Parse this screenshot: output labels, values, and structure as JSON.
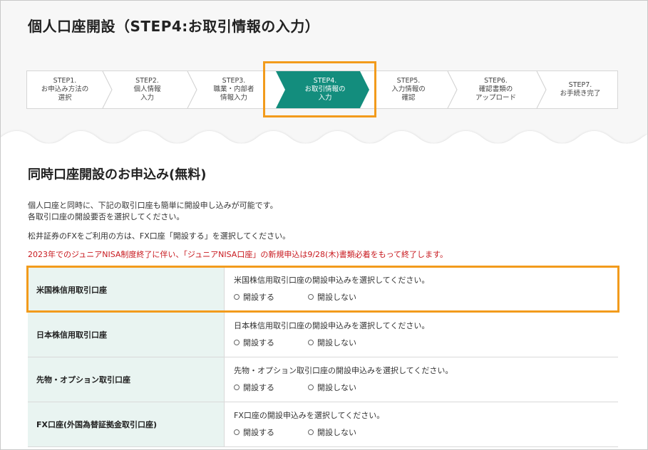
{
  "page": {
    "title": "個人口座開設（STEP4:お取引情報の入力）"
  },
  "steps": [
    {
      "label": "STEP1.\nお申込み方法の\n選択"
    },
    {
      "label": "STEP2.\n個人情報\n入力"
    },
    {
      "label": "STEP3.\n職業・内部者\n情報入力"
    },
    {
      "label": "STEP4.\nお取引情報の\n入力",
      "active": true
    },
    {
      "label": "STEP5.\n入力情報の\n確認"
    },
    {
      "label": "STEP6.\n確認書類の\nアップロード"
    },
    {
      "label": "STEP7.\nお手続き完了"
    }
  ],
  "colors": {
    "accent": "#138d7d",
    "highlight": "#f29b1c",
    "notice": "#c8181e",
    "table_header_bg": "#e9f4f1"
  },
  "section": {
    "title": "同時口座開設のお申込み(無料)",
    "intro_line1": "個人口座と同時に、下記の取引口座も簡単に開設申し込みが可能です。",
    "intro_line2": "各取引口座の開設要否を選択してください。",
    "fx_note": "松井証券のFXをご利用の方は、FX口座「開設する」を選択してください。",
    "notice": "2023年でのジュニアNISA制度終了に伴い、「ジュニアNISA口座」の新規申込は9/28(木)書類必着をもって終了します。"
  },
  "accounts": [
    {
      "name": "米国株信用取引口座",
      "question": "米国株信用取引口座の開設申込みを選択してください。",
      "open": "開設する",
      "no_open": "開設しない"
    },
    {
      "name": "日本株信用取引口座",
      "question": "日本株信用取引口座の開設申込みを選択してください。",
      "open": "開設する",
      "no_open": "開設しない"
    },
    {
      "name": "先物・オプション取引口座",
      "question": "先物・オプション取引口座の開設申込みを選択してください。",
      "open": "開設する",
      "no_open": "開設しない"
    },
    {
      "name": "FX口座(外国為替証拠金取引口座)",
      "question": "FX口座の開設申込みを選択してください。",
      "open": "開設する",
      "no_open": "開設しない"
    }
  ]
}
